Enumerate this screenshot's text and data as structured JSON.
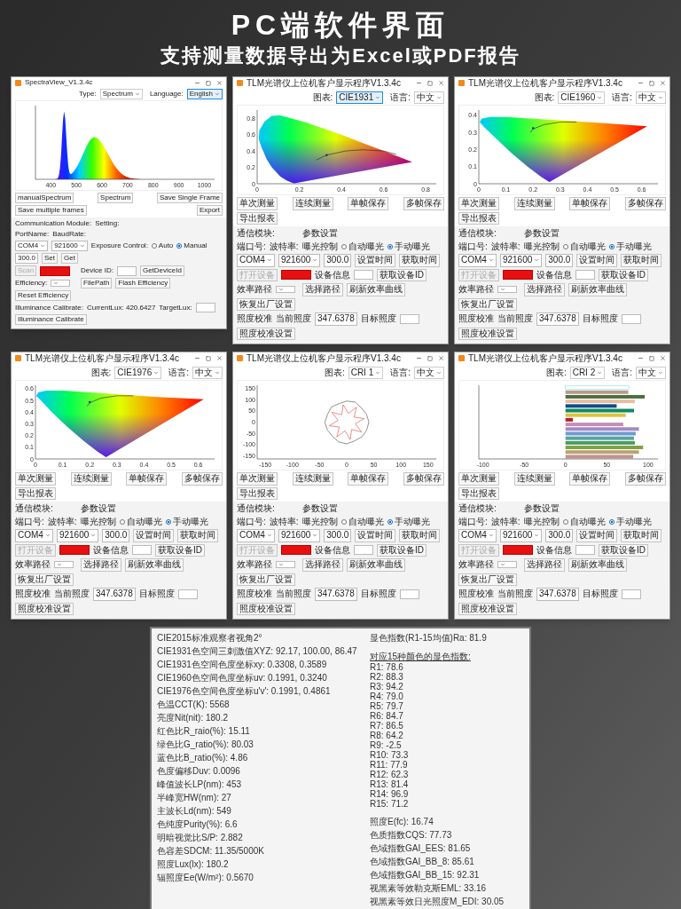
{
  "header": {
    "title": "PC端软件界面",
    "subtitle": "支持测量数据导出为Excel或PDF报告"
  },
  "windows": [
    {
      "kind": "compact",
      "title": "SpectraView_V1.3.4c",
      "toolbar": [
        {
          "label": "Type:",
          "value": "Spectrum",
          "focused": false
        },
        {
          "label": "Language:",
          "value": "English",
          "focused": true
        }
      ],
      "chart": {
        "kind": "spectrum",
        "x_ticks": [
          "400",
          "500",
          "600",
          "700",
          "800",
          "900",
          "1000"
        ]
      },
      "buttons": [
        "manualSpectrum",
        "Spectrum",
        "Save Single Frame",
        "Save multiple frames",
        "Export"
      ],
      "panel": [
        {
          "left": [
            {
              "kind": "label",
              "text": "Communication Module:"
            }
          ],
          "right": [
            {
              "kind": "label",
              "text": "Setting:"
            }
          ]
        },
        {
          "left": [
            {
              "kind": "label",
              "text": "PortName:"
            },
            {
              "kind": "label",
              "text": "BaudRate:"
            }
          ]
        },
        {
          "left": [
            {
              "kind": "select",
              "text": "COM4"
            },
            {
              "kind": "select",
              "text": "921600"
            }
          ],
          "right": [
            {
              "kind": "label",
              "text": "Exposure Control:"
            },
            {
              "kind": "radio",
              "text": "Auto",
              "selected": false
            },
            {
              "kind": "radio",
              "text": "Manual",
              "selected": true
            },
            {
              "kind": "input",
              "text": "300.0"
            },
            {
              "kind": "button",
              "text": "Set",
              "disabled": false
            },
            {
              "kind": "button",
              "text": "Get",
              "disabled": false
            }
          ]
        },
        {
          "left": [
            {
              "kind": "button",
              "text": "Scan",
              "disabled": true
            },
            {
              "kind": "alert"
            }
          ],
          "right": [
            {
              "kind": "label",
              "text": "Device ID:"
            },
            {
              "kind": "input"
            },
            {
              "kind": "button",
              "text": "GetDeviceId",
              "disabled": false
            }
          ]
        },
        {
          "left": [
            {
              "kind": "label",
              "text": "Efficiency:"
            },
            {
              "kind": "select"
            }
          ],
          "right": [
            {
              "kind": "button",
              "text": "FilePath",
              "disabled": false
            },
            {
              "kind": "button",
              "text": "Flash Efficiency",
              "disabled": false
            },
            {
              "kind": "button",
              "text": "Reset Efficiency",
              "disabled": false
            }
          ]
        },
        {
          "left": [
            {
              "kind": "label",
              "text": "Illuminance Calibrate:"
            },
            {
              "kind": "label",
              "text": "CurrentLux: 420.6427"
            }
          ],
          "right": [
            {
              "kind": "label",
              "text": "TargetLux:"
            },
            {
              "kind": "input"
            },
            {
              "kind": "button",
              "text": "Illuminance Calibrate",
              "disabled": false
            }
          ]
        }
      ]
    },
    {
      "kind": "standard",
      "title": "TLM光谱仪上位机客户显示程序V1.3.4c",
      "toolbar": [
        {
          "label": "图表:",
          "value": "CIE1931",
          "focused": true
        },
        {
          "label": "语言:",
          "value": "中文",
          "focused": false
        }
      ],
      "chart": {
        "kind": "cie1931",
        "x_ticks": [
          "0",
          "0.2",
          "0.4",
          "0.6",
          "0.8"
        ],
        "y_ticks": [
          "0.8",
          "0.6",
          "0.4",
          "0.2",
          "0"
        ]
      },
      "buttons": [
        "单次测量",
        "连续测量",
        "单帧保存",
        "多帧保存",
        "导出报表"
      ],
      "panel": [
        {
          "left": [
            {
              "kind": "label",
              "text": "通信模块:"
            }
          ],
          "right": [
            {
              "kind": "label",
              "text": "参数设置"
            }
          ]
        },
        {
          "left": [
            {
              "kind": "label",
              "text": "端口号:"
            },
            {
              "kind": "label",
              "text": "波特率:"
            }
          ],
          "right": [
            {
              "kind": "label",
              "text": "曝光控制"
            },
            {
              "kind": "radio",
              "text": "自动曝光",
              "selected": false
            },
            {
              "kind": "radio",
              "text": "手动曝光",
              "selected": true
            }
          ]
        },
        {
          "left": [
            {
              "kind": "select",
              "text": "COM4"
            },
            {
              "kind": "select",
              "text": "921600"
            }
          ],
          "right": [
            {
              "kind": "input",
              "text": "300.0"
            },
            {
              "kind": "button",
              "text": "设置时间",
              "disabled": false
            },
            {
              "kind": "button",
              "text": "获取时间",
              "disabled": false
            }
          ]
        },
        {
          "left": [
            {
              "kind": "button",
              "text": "打开设备",
              "disabled": true
            },
            {
              "kind": "alert"
            }
          ],
          "right": [
            {
              "kind": "label",
              "text": "设备信息"
            },
            {
              "kind": "input"
            },
            {
              "kind": "button",
              "text": "获取设备ID",
              "disabled": false
            }
          ]
        },
        {
          "left": [
            {
              "kind": "label",
              "text": "效率路径"
            },
            {
              "kind": "select"
            }
          ],
          "right": [
            {
              "kind": "button",
              "text": "选择路径",
              "disabled": false
            },
            {
              "kind": "button",
              "text": "刷新效率曲线",
              "disabled": false
            },
            {
              "kind": "button",
              "text": "恢复出厂设置",
              "disabled": false
            }
          ]
        },
        {
          "left": [
            {
              "kind": "label",
              "text": "照度校准"
            },
            {
              "kind": "label",
              "text": "当前照度"
            },
            {
              "kind": "input",
              "text": "347.6378"
            }
          ],
          "right": [
            {
              "kind": "label",
              "text": "目标照度"
            },
            {
              "kind": "input"
            },
            {
              "kind": "button",
              "text": "照度校准设置",
              "disabled": false
            }
          ]
        }
      ]
    },
    {
      "kind": "standard",
      "title": "TLM光谱仪上位机客户显示程序V1.3.4c",
      "toolbar": [
        {
          "label": "图表:",
          "value": "CIE1960",
          "focused": false
        },
        {
          "label": "语言:",
          "value": "中文",
          "focused": false
        }
      ],
      "chart": {
        "kind": "cie1960",
        "x_ticks": [
          "0",
          "0.1",
          "0.2",
          "0.3",
          "0.4",
          "0.5",
          "0.6"
        ],
        "y_ticks": [
          "0.4",
          "0.3",
          "0.2",
          "0.1",
          "0"
        ]
      },
      "buttons": [
        "单次测量",
        "连续测量",
        "单帧保存",
        "多帧保存",
        "导出报表"
      ],
      "panel": [
        {
          "left": [
            {
              "kind": "label",
              "text": "通信模块:"
            }
          ],
          "right": [
            {
              "kind": "label",
              "text": "参数设置"
            }
          ]
        },
        {
          "left": [
            {
              "kind": "label",
              "text": "端口号:"
            },
            {
              "kind": "label",
              "text": "波特率:"
            }
          ],
          "right": [
            {
              "kind": "label",
              "text": "曝光控制"
            },
            {
              "kind": "radio",
              "text": "自动曝光",
              "selected": false
            },
            {
              "kind": "radio",
              "text": "手动曝光",
              "selected": true
            }
          ]
        },
        {
          "left": [
            {
              "kind": "select",
              "text": "COM4"
            },
            {
              "kind": "select",
              "text": "921600"
            }
          ],
          "right": [
            {
              "kind": "input",
              "text": "300.0"
            },
            {
              "kind": "button",
              "text": "设置时间",
              "disabled": false
            },
            {
              "kind": "button",
              "text": "获取时间",
              "disabled": false
            }
          ]
        },
        {
          "left": [
            {
              "kind": "button",
              "text": "打开设备",
              "disabled": true
            },
            {
              "kind": "alert"
            }
          ],
          "right": [
            {
              "kind": "label",
              "text": "设备信息"
            },
            {
              "kind": "input"
            },
            {
              "kind": "button",
              "text": "获取设备ID",
              "disabled": false
            }
          ]
        },
        {
          "left": [
            {
              "kind": "label",
              "text": "效率路径"
            },
            {
              "kind": "select"
            }
          ],
          "right": [
            {
              "kind": "button",
              "text": "选择路径",
              "disabled": false
            },
            {
              "kind": "button",
              "text": "刷新效率曲线",
              "disabled": false
            },
            {
              "kind": "button",
              "text": "恢复出厂设置",
              "disabled": false
            }
          ]
        },
        {
          "left": [
            {
              "kind": "label",
              "text": "照度校准"
            },
            {
              "kind": "label",
              "text": "当前照度"
            },
            {
              "kind": "input",
              "text": "347.6378"
            }
          ],
          "right": [
            {
              "kind": "label",
              "text": "目标照度"
            },
            {
              "kind": "input"
            },
            {
              "kind": "button",
              "text": "照度校准设置",
              "disabled": false
            }
          ]
        }
      ]
    },
    {
      "kind": "standard",
      "title": "TLM光谱仪上位机客户显示程序V1.3.4c",
      "toolbar": [
        {
          "label": "图表:",
          "value": "CIE1976",
          "focused": false
        },
        {
          "label": "语言:",
          "value": "中文",
          "focused": false
        }
      ],
      "chart": {
        "kind": "cie1976",
        "x_ticks": [
          "0",
          "0.1",
          "0.2",
          "0.3",
          "0.4",
          "0.5",
          "0.6"
        ],
        "y_ticks": [
          "0.6",
          "0.5",
          "0.4",
          "0.3",
          "0.2",
          "0.1",
          "0"
        ]
      },
      "buttons": [
        "单次测量",
        "连续测量",
        "单帧保存",
        "多帧保存",
        "导出报表"
      ],
      "panel": [
        {
          "left": [
            {
              "kind": "label",
              "text": "通信模块:"
            }
          ],
          "right": [
            {
              "kind": "label",
              "text": "参数设置"
            }
          ]
        },
        {
          "left": [
            {
              "kind": "label",
              "text": "端口号:"
            },
            {
              "kind": "label",
              "text": "波特率:"
            }
          ],
          "right": [
            {
              "kind": "label",
              "text": "曝光控制"
            },
            {
              "kind": "radio",
              "text": "自动曝光",
              "selected": false
            },
            {
              "kind": "radio",
              "text": "手动曝光",
              "selected": true
            }
          ]
        },
        {
          "left": [
            {
              "kind": "select",
              "text": "COM4"
            },
            {
              "kind": "select",
              "text": "921600"
            }
          ],
          "right": [
            {
              "kind": "input",
              "text": "300.0"
            },
            {
              "kind": "button",
              "text": "设置时间",
              "disabled": false
            },
            {
              "kind": "button",
              "text": "获取时间",
              "disabled": false
            }
          ]
        },
        {
          "left": [
            {
              "kind": "button",
              "text": "打开设备",
              "disabled": true
            },
            {
              "kind": "alert"
            }
          ],
          "right": [
            {
              "kind": "label",
              "text": "设备信息"
            },
            {
              "kind": "input"
            },
            {
              "kind": "button",
              "text": "获取设备ID",
              "disabled": false
            }
          ]
        },
        {
          "left": [
            {
              "kind": "label",
              "text": "效率路径"
            },
            {
              "kind": "select"
            }
          ],
          "right": [
            {
              "kind": "button",
              "text": "选择路径",
              "disabled": false
            },
            {
              "kind": "button",
              "text": "刷新效率曲线",
              "disabled": false
            },
            {
              "kind": "button",
              "text": "恢复出厂设置",
              "disabled": false
            }
          ]
        },
        {
          "left": [
            {
              "kind": "label",
              "text": "照度校准"
            },
            {
              "kind": "label",
              "text": "当前照度"
            },
            {
              "kind": "input",
              "text": "347.6378"
            }
          ],
          "right": [
            {
              "kind": "label",
              "text": "目标照度"
            },
            {
              "kind": "input"
            },
            {
              "kind": "button",
              "text": "照度校准设置",
              "disabled": false
            }
          ]
        }
      ]
    },
    {
      "kind": "standard",
      "title": "TLM光谱仪上位机客户显示程序V1.3.4c",
      "toolbar": [
        {
          "label": "图表:",
          "value": "CRI 1",
          "focused": false
        },
        {
          "label": "语言:",
          "value": "中文",
          "focused": false
        }
      ],
      "chart": {
        "kind": "polar",
        "x_ticks": [
          "-150",
          "-100",
          "-50",
          "0",
          "50",
          "100",
          "150"
        ],
        "y_ticks": [
          "150",
          "100",
          "50",
          "0",
          "-50",
          "-100",
          "-150"
        ]
      },
      "buttons": [
        "单次测量",
        "连续测量",
        "单帧保存",
        "多帧保存",
        "导出报表"
      ],
      "panel": [
        {
          "left": [
            {
              "kind": "label",
              "text": "通信模块:"
            }
          ],
          "right": [
            {
              "kind": "label",
              "text": "参数设置"
            }
          ]
        },
        {
          "left": [
            {
              "kind": "label",
              "text": "端口号:"
            },
            {
              "kind": "label",
              "text": "波特率:"
            }
          ],
          "right": [
            {
              "kind": "label",
              "text": "曝光控制"
            },
            {
              "kind": "radio",
              "text": "自动曝光",
              "selected": false
            },
            {
              "kind": "radio",
              "text": "手动曝光",
              "selected": true
            }
          ]
        },
        {
          "left": [
            {
              "kind": "select",
              "text": "COM4"
            },
            {
              "kind": "select",
              "text": "921600"
            }
          ],
          "right": [
            {
              "kind": "input",
              "text": "300.0"
            },
            {
              "kind": "button",
              "text": "设置时间",
              "disabled": false
            },
            {
              "kind": "button",
              "text": "获取时间",
              "disabled": false
            }
          ]
        },
        {
          "left": [
            {
              "kind": "button",
              "text": "打开设备",
              "disabled": true
            },
            {
              "kind": "alert"
            }
          ],
          "right": [
            {
              "kind": "label",
              "text": "设备信息"
            },
            {
              "kind": "input"
            },
            {
              "kind": "button",
              "text": "获取设备ID",
              "disabled": false
            }
          ]
        },
        {
          "left": [
            {
              "kind": "label",
              "text": "效率路径"
            },
            {
              "kind": "select"
            }
          ],
          "right": [
            {
              "kind": "button",
              "text": "选择路径",
              "disabled": false
            },
            {
              "kind": "button",
              "text": "刷新效率曲线",
              "disabled": false
            },
            {
              "kind": "button",
              "text": "恢复出厂设置",
              "disabled": false
            }
          ]
        },
        {
          "left": [
            {
              "kind": "label",
              "text": "照度校准"
            },
            {
              "kind": "label",
              "text": "当前照度"
            },
            {
              "kind": "input",
              "text": "347.6378"
            }
          ],
          "right": [
            {
              "kind": "label",
              "text": "目标照度"
            },
            {
              "kind": "input"
            },
            {
              "kind": "button",
              "text": "照度校准设置",
              "disabled": false
            }
          ]
        }
      ]
    },
    {
      "kind": "standard",
      "title": "TLM光谱仪上位机客户显示程序V1.3.4c",
      "toolbar": [
        {
          "label": "图表:",
          "value": "CRI 2",
          "focused": false
        },
        {
          "label": "语言:",
          "value": "中文",
          "focused": false
        }
      ],
      "chart": {
        "kind": "bar",
        "chart_data": {
          "type": "bar",
          "orientation": "horizontal",
          "categories": [
            null,
            null,
            null,
            null,
            null,
            null,
            null,
            null,
            null,
            null,
            null,
            null,
            null,
            null,
            null,
            null
          ],
          "xticks": [
            -100,
            -50,
            0,
            50,
            100
          ],
          "xlim": [
            -105,
            112
          ],
          "values": [
            77,
            76,
            96,
            84,
            62,
            83,
            73,
            9,
            70,
            89,
            85,
            83,
            84,
            94,
            89,
            82
          ]
        }
      },
      "buttons": [
        "单次测量",
        "连续测量",
        "单帧保存",
        "多帧保存",
        "导出报表"
      ],
      "panel": [
        {
          "left": [
            {
              "kind": "label",
              "text": "通信模块:"
            }
          ],
          "right": [
            {
              "kind": "label",
              "text": "参数设置"
            }
          ]
        },
        {
          "left": [
            {
              "kind": "label",
              "text": "端口号:"
            },
            {
              "kind": "label",
              "text": "波特率:"
            }
          ],
          "right": [
            {
              "kind": "label",
              "text": "曝光控制"
            },
            {
              "kind": "radio",
              "text": "自动曝光",
              "selected": false
            },
            {
              "kind": "radio",
              "text": "手动曝光",
              "selected": true
            }
          ]
        },
        {
          "left": [
            {
              "kind": "select",
              "text": "COM4"
            },
            {
              "kind": "select",
              "text": "921600"
            }
          ],
          "right": [
            {
              "kind": "input",
              "text": "300.0"
            },
            {
              "kind": "button",
              "text": "设置时间",
              "disabled": false
            },
            {
              "kind": "button",
              "text": "获取时间",
              "disabled": false
            }
          ]
        },
        {
          "left": [
            {
              "kind": "button",
              "text": "打开设备",
              "disabled": true
            },
            {
              "kind": "alert"
            }
          ],
          "right": [
            {
              "kind": "label",
              "text": "设备信息"
            },
            {
              "kind": "input"
            },
            {
              "kind": "button",
              "text": "获取设备ID",
              "disabled": false
            }
          ]
        },
        {
          "left": [
            {
              "kind": "label",
              "text": "效率路径"
            },
            {
              "kind": "select"
            }
          ],
          "right": [
            {
              "kind": "button",
              "text": "选择路径",
              "disabled": false
            },
            {
              "kind": "button",
              "text": "刷新效率曲线",
              "disabled": false
            },
            {
              "kind": "button",
              "text": "恢复出厂设置",
              "disabled": false
            }
          ]
        },
        {
          "left": [
            {
              "kind": "label",
              "text": "照度校准"
            },
            {
              "kind": "label",
              "text": "当前照度"
            },
            {
              "kind": "input",
              "text": "347.6378"
            }
          ],
          "right": [
            {
              "kind": "label",
              "text": "目标照度"
            },
            {
              "kind": "input"
            },
            {
              "kind": "button",
              "text": "照度校准设置",
              "disabled": false
            }
          ]
        }
      ]
    }
  ],
  "results": {
    "left": [
      "CIE2015标准观察者视角2°",
      "CIE1931色空间三刺激值XYZ: 92.17, 100.00, 86.47",
      "CIE1931色空间色度坐标xy: 0.3308, 0.3589",
      "CIE1960色空间色度坐标uv: 0.1991, 0.3240",
      "CIE1976色空间色度坐标u'v': 0.1991, 0.4861",
      "色温CCT(K): 5568",
      "亮度Nit(nit): 180.2",
      "红色比R_raio(%): 15.11",
      "绿色比G_ratio(%): 80.03",
      "蓝色比B_ratio(%): 4.86",
      "色度偏移Duv: 0.0096",
      "峰值波长LP(nm): 453",
      "半峰宽HW(nm): 27",
      "主波长Ld(nm): 549",
      "色纯度Purity(%): 6.6",
      "明暗视觉比S/P: 2.882",
      "色容差SDCM: 11.35/5000K",
      "照度Lux(lx): 180.2",
      "辐照度Ee(W/m²): 0.5670"
    ],
    "ra": "显色指数(R1-15均值)Ra: 81.9",
    "cri_heading": "对应15种颜色的显色指数:",
    "cri": [
      "R1: 78.6",
      "R2: 88.3",
      "R3: 94.2",
      "R4: 79.0",
      "R5: 79.7",
      "R6: 84.7",
      "R7: 86.5",
      "R8: 64.2",
      "R9: -2.5",
      "R10: 73.3",
      "R11: 77.9",
      "R12: 62.3",
      "R13: 81.4",
      "R14: 96.9",
      "R15: 71.2"
    ],
    "right": [
      "照度E(fc): 16.74",
      "色质指数CQS: 77.73",
      "色域指数GAI_EES: 81.65",
      "色域指数GAI_BB_8: 85.61",
      "色域指数GAI_BB_15: 92.31",
      "视黑素等效勒克斯EML: 33.16",
      "视黑素等效日光照度M_EDI: 30.05"
    ]
  }
}
